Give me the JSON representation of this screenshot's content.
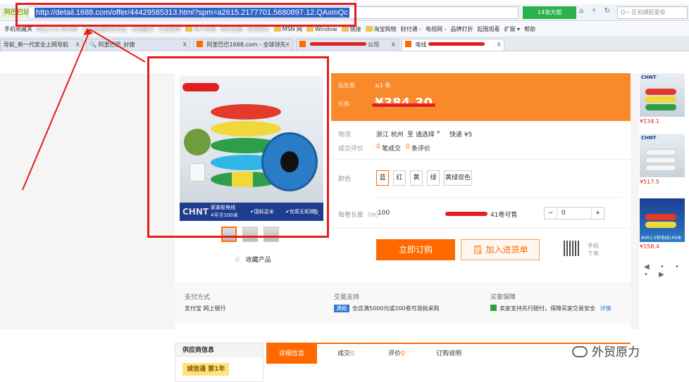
{
  "browser": {
    "site_badge": "阿巴巴站",
    "url": "http://detail.1688.com/offer/44429585313.html?spm=a2615.2177701.5680897.12.QAxmQc",
    "capture_button": "14张大图",
    "nav_icons": "⌂ ⚡ ↻ ∨",
    "search_placeholder": "Q~ 区伯娜配夏极",
    "bookmarks": [
      {
        "label": "手机收藏夹",
        "blur": false,
        "folder": false
      },
      {
        "label": "网址大全 移动版",
        "blur": true,
        "folder": false
      },
      {
        "label": "京东商城网站导航",
        "blur": true,
        "folder": false
      },
      {
        "label": "在线翻译",
        "blur": true,
        "folder": false
      },
      {
        "label": "百度搜索",
        "blur": true,
        "folder": false
      },
      {
        "label": "电子邮箱",
        "blur": true,
        "folder": true
      },
      {
        "label": "我的收藏",
        "blur": true,
        "folder": false
      },
      {
        "label": "常用网址",
        "blur": true,
        "folder": false
      },
      {
        "label": "MSN 网",
        "blur": false,
        "folder": true
      },
      {
        "label": "Window",
        "blur": false,
        "folder": true
      },
      {
        "label": "链接",
        "blur": false,
        "folder": true
      },
      {
        "label": "淘宝购物",
        "blur": false,
        "folder": true
      },
      {
        "label": "财付通 -",
        "blur": false,
        "folder": false
      },
      {
        "label": "电视网 -",
        "blur": false,
        "folder": false
      },
      {
        "label": "品牌打折",
        "blur": false,
        "folder": false
      },
      {
        "label": "起围观看",
        "blur": false,
        "folder": false
      },
      {
        "label": "扩展 ▾",
        "blur": false,
        "folder": false
      },
      {
        "label": "帮助",
        "blur": false,
        "folder": false
      }
    ],
    "tabs": [
      {
        "label": "导航_新一代安全上网导航",
        "close": "X"
      },
      {
        "label": "阿里巴巴_好搜",
        "close": "X"
      },
      {
        "label": "阿里巴巴1688.com - 全球领先",
        "close": "X"
      },
      {
        "label": "公司",
        "close": "X"
      },
      {
        "label": "电线",
        "close": "X"
      }
    ]
  },
  "product": {
    "banner_brand": "CHNT",
    "banner_spec1": "家装软电线",
    "banner_spec2": "4平方100米",
    "banner_cert1": "✔国标足米",
    "banner_cert2": "✔优质无氧铜",
    "zoom_icon": "🔍",
    "favorite_star": "☆",
    "favorite_label": "收藏产品"
  },
  "buy": {
    "price_range_label": "起批量",
    "price_range_value": "≥1 卷",
    "price_label": "价格",
    "price_value": "¥384.30",
    "shipping_label": "物流",
    "shipping_from": "浙江 杭州",
    "shipping_to": "至 请选择",
    "shipping_fee": "快递 ¥5",
    "deals_label": "成交评价",
    "deals_count": "0",
    "deals_text": "笔成交",
    "reviews_count": "0",
    "reviews_text": "条评价",
    "color_label": "颜色",
    "colors": [
      "蓝",
      "红",
      "黄",
      "绿",
      "黄绿双色"
    ],
    "length_label": "每卷长度（m）",
    "length_value": "100",
    "stock_text": "41卷可售",
    "qty_minus": "−",
    "qty_value": "0",
    "qty_plus": "+",
    "order_button": "立即订购",
    "cart_button": "加入进货单",
    "mobile_text_1": "手机",
    "mobile_text_2": "下单"
  },
  "service": {
    "payment_title": "支付方式",
    "payment_text": "支付宝    网上银行",
    "support_title": "交易支持",
    "support_badge": "满批",
    "support_text": "全店满5000元或200卷可混批采购",
    "protect_title": "买家保障",
    "protect_text": "卖家支持先行赔付，保障买家交易安全",
    "protect_link": "详情"
  },
  "rail": {
    "items": [
      {
        "brand": "CHNT",
        "caption": "",
        "price": "¥134.1"
      },
      {
        "brand": "CHNT",
        "caption": "",
        "price": "¥517.5"
      },
      {
        "brand": "",
        "caption": "BVR1.5软电线100米",
        "price": "¥158.4"
      }
    ],
    "nav": "◀ • • • ▶"
  },
  "bottom": {
    "supplier_title": "供应商信息",
    "supplier_badge": "诚信通  第1年",
    "tabs": [
      {
        "label": "详细信息",
        "count": ""
      },
      {
        "label": "成交",
        "count": "0"
      },
      {
        "label": "评价",
        "count": "0"
      },
      {
        "label": "订购说明",
        "count": ""
      }
    ],
    "watermark": "外贸原力"
  }
}
